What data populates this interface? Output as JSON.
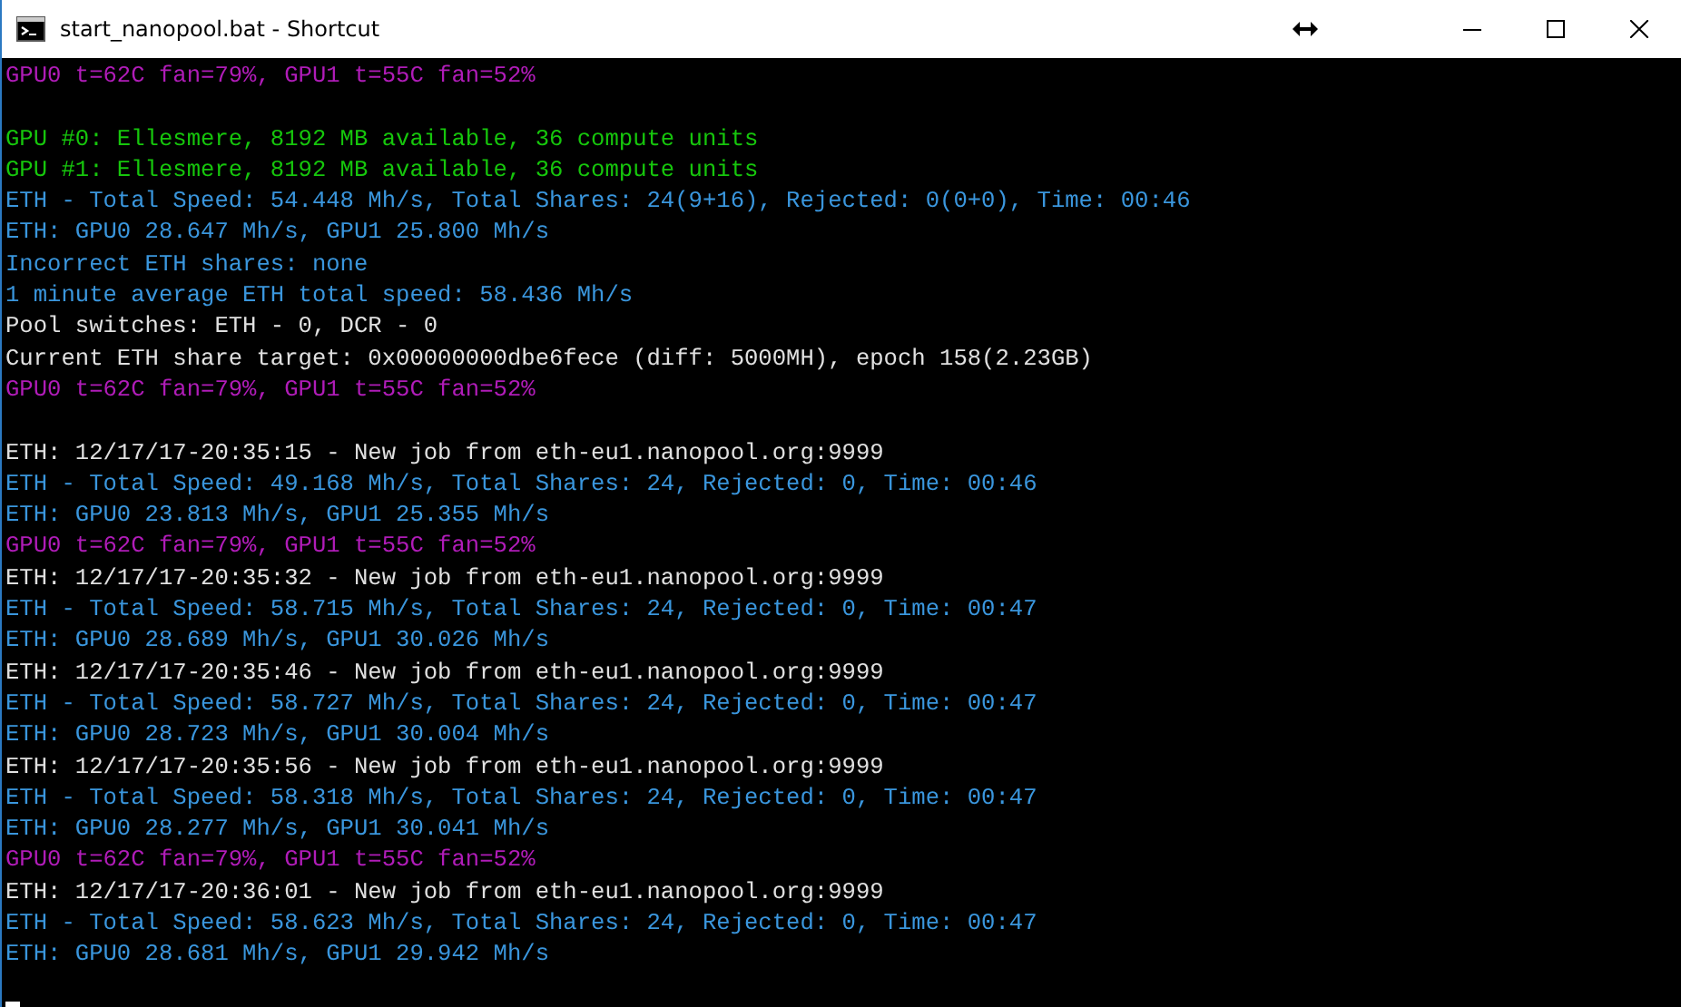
{
  "window": {
    "title": "start_nanopool.bat - Shortcut"
  },
  "console_lines": [
    {
      "kind": "temp",
      "text": "GPU0 t=62C fan=79%, GPU1 t=55C fan=52%"
    },
    {
      "kind": "blank"
    },
    {
      "kind": "info",
      "text": "GPU #0: Ellesmere, 8192 MB available, 36 compute units"
    },
    {
      "kind": "info",
      "text": "GPU #1: Ellesmere, 8192 MB available, 36 compute units"
    },
    {
      "kind": "stat",
      "text": "ETH - Total Speed: 54.448 Mh/s, Total Shares: 24(9+16), Rejected: 0(0+0), Time: 00:46"
    },
    {
      "kind": "stat",
      "text": "ETH: GPU0 28.647 Mh/s, GPU1 25.800 Mh/s"
    },
    {
      "kind": "stat",
      "text": "Incorrect ETH shares: none"
    },
    {
      "kind": "stat",
      "text": "1 minute average ETH total speed: 58.436 Mh/s"
    },
    {
      "kind": "plain",
      "text": "Pool switches: ETH - 0, DCR - 0"
    },
    {
      "kind": "plain",
      "text": "Current ETH share target: 0x00000000dbe6fece (diff: 5000MH), epoch 158(2.23GB)"
    },
    {
      "kind": "temp",
      "text": "GPU0 t=62C fan=79%, GPU1 t=55C fan=52%"
    },
    {
      "kind": "blank"
    },
    {
      "kind": "plain",
      "text": "ETH: 12/17/17-20:35:15 - New job from eth-eu1.nanopool.org:9999"
    },
    {
      "kind": "stat",
      "text": "ETH - Total Speed: 49.168 Mh/s, Total Shares: 24, Rejected: 0, Time: 00:46"
    },
    {
      "kind": "stat",
      "text": "ETH: GPU0 23.813 Mh/s, GPU1 25.355 Mh/s"
    },
    {
      "kind": "temp",
      "text": "GPU0 t=62C fan=79%, GPU1 t=55C fan=52%"
    },
    {
      "kind": "plain",
      "text": "ETH: 12/17/17-20:35:32 - New job from eth-eu1.nanopool.org:9999"
    },
    {
      "kind": "stat",
      "text": "ETH - Total Speed: 58.715 Mh/s, Total Shares: 24, Rejected: 0, Time: 00:47"
    },
    {
      "kind": "stat",
      "text": "ETH: GPU0 28.689 Mh/s, GPU1 30.026 Mh/s"
    },
    {
      "kind": "plain",
      "text": "ETH: 12/17/17-20:35:46 - New job from eth-eu1.nanopool.org:9999"
    },
    {
      "kind": "stat",
      "text": "ETH - Total Speed: 58.727 Mh/s, Total Shares: 24, Rejected: 0, Time: 00:47"
    },
    {
      "kind": "stat",
      "text": "ETH: GPU0 28.723 Mh/s, GPU1 30.004 Mh/s"
    },
    {
      "kind": "plain",
      "text": "ETH: 12/17/17-20:35:56 - New job from eth-eu1.nanopool.org:9999"
    },
    {
      "kind": "stat",
      "text": "ETH - Total Speed: 58.318 Mh/s, Total Shares: 24, Rejected: 0, Time: 00:47"
    },
    {
      "kind": "stat",
      "text": "ETH: GPU0 28.277 Mh/s, GPU1 30.041 Mh/s"
    },
    {
      "kind": "temp",
      "text": "GPU0 t=62C fan=79%, GPU1 t=55C fan=52%"
    },
    {
      "kind": "plain",
      "text": "ETH: 12/17/17-20:36:01 - New job from eth-eu1.nanopool.org:9999"
    },
    {
      "kind": "stat",
      "text": "ETH - Total Speed: 58.623 Mh/s, Total Shares: 24, Rejected: 0, Time: 00:47"
    },
    {
      "kind": "stat",
      "text": "ETH: GPU0 28.681 Mh/s, GPU1 29.942 Mh/s"
    },
    {
      "kind": "blank"
    }
  ]
}
